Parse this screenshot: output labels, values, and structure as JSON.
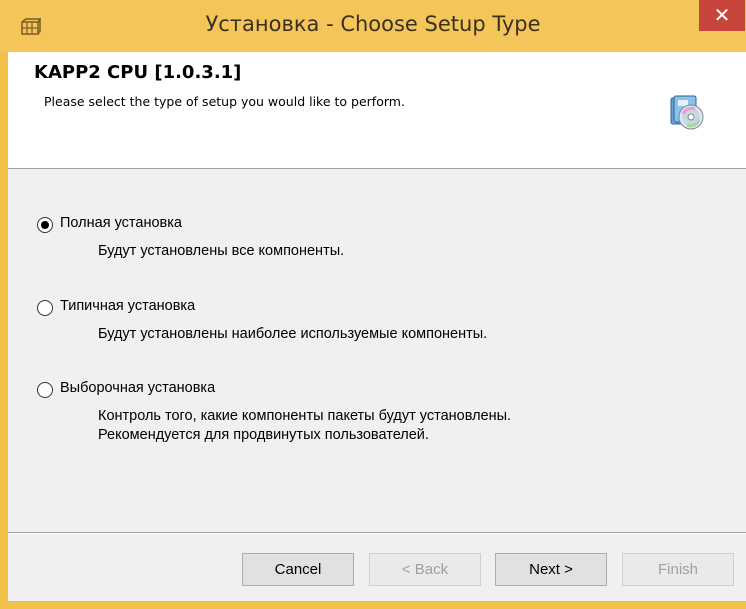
{
  "window": {
    "title": "Установка - Choose Setup Type",
    "close_glyph": "✕"
  },
  "header": {
    "product_title": "KAPP2 CPU [1.0.3.1]",
    "subtitle": "Please select the type of setup you would like to perform.",
    "icon": "setup-disc-icon"
  },
  "options": [
    {
      "label": "Полная установка",
      "description": [
        "Будут установлены все компоненты."
      ],
      "selected": true
    },
    {
      "label": "Типичная установка",
      "description": [
        "Будут установлены наиболее используемые компоненты."
      ],
      "selected": false
    },
    {
      "label": "Выборочная установка",
      "description": [
        "Контроль того, какие компоненты пакеты будут установлены.",
        "Рекомендуется для продвинутых пользователей."
      ],
      "selected": false
    }
  ],
  "buttons": {
    "cancel": "Cancel",
    "back": "< Back",
    "next": "Next >",
    "finish": "Finish"
  },
  "colors": {
    "titlebar": "#f4c65a",
    "close": "#c7453b",
    "dialog_bg": "#f0f0f0"
  }
}
